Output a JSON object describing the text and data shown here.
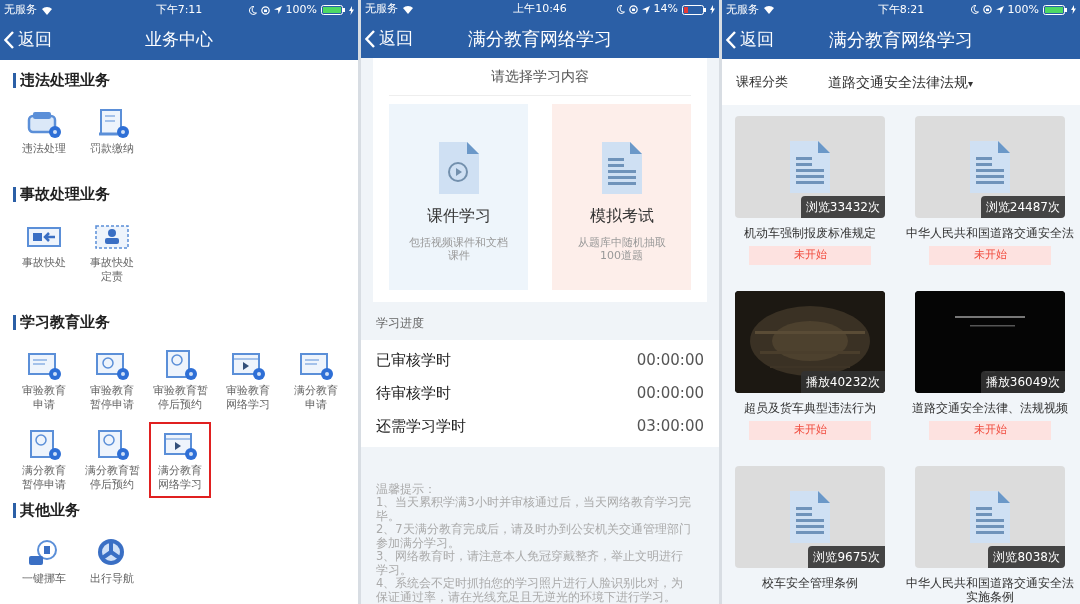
{
  "screen_1": {
    "status_bar": {
      "carrier": "无服务",
      "time": "下午7:11",
      "battery": "100%",
      "battery_low": false
    },
    "nav": {
      "back": "返回",
      "title": "业务中心"
    },
    "sections": [
      {
        "title": "违法处理业务",
        "items": [
          {
            "kind": "car",
            "lines": [
              "违法处理"
            ],
            "highlighted": false
          },
          {
            "kind": "scroll",
            "lines": [
              "罚款缴纳"
            ],
            "highlighted": false
          }
        ]
      },
      {
        "title": "事故处理业务",
        "items": [
          {
            "kind": "accident",
            "lines": [
              "事故快处"
            ],
            "highlighted": false
          },
          {
            "kind": "person",
            "lines": [
              "事故快处",
              "定责"
            ],
            "highlighted": false
          }
        ]
      },
      {
        "title": "学习教育业务",
        "items": [
          {
            "kind": "form",
            "lines": [
              "审验教育",
              "申请"
            ],
            "highlighted": false
          },
          {
            "kind": "clock",
            "lines": [
              "审验教育",
              "暂停申请"
            ],
            "highlighted": false
          },
          {
            "kind": "clock_doc",
            "lines": [
              "审验教育暂",
              "停后预约"
            ],
            "highlighted": false
          },
          {
            "kind": "play",
            "lines": [
              "审验教育",
              "网络学习"
            ],
            "highlighted": false
          },
          {
            "kind": "form",
            "lines": [
              "满分教育",
              "申请"
            ],
            "highlighted": false
          },
          {
            "kind": "clock_doc",
            "lines": [
              "满分教育",
              "暂停申请"
            ],
            "highlighted": false
          },
          {
            "kind": "clock_doc",
            "lines": [
              "满分教育暂",
              "停后预约"
            ],
            "highlighted": false
          },
          {
            "kind": "play",
            "lines": [
              "满分教育",
              "网络学习"
            ],
            "highlighted": true
          }
        ]
      },
      {
        "title": "其他业务",
        "items": [
          {
            "kind": "move_car",
            "lines": [
              "一键挪车"
            ],
            "highlighted": false
          },
          {
            "kind": "wheel",
            "lines": [
              "出行导航"
            ],
            "highlighted": false
          }
        ]
      }
    ]
  },
  "screen_2": {
    "status_bar": {
      "carrier": "无服务",
      "time": "上午10:46",
      "battery": "14%",
      "battery_low": true
    },
    "nav": {
      "back": "返回",
      "title": "满分教育网络学习"
    },
    "choose_title": "请选择学习内容",
    "options": [
      {
        "kind": "video",
        "title": "课件学习",
        "description": "包括视频课件和文档课件"
      },
      {
        "kind": "document",
        "title": "模拟考试",
        "description": "从题库中随机抽取100道题"
      }
    ],
    "progress": {
      "title": "学习进度",
      "rows": [
        {
          "label": "已审核学时",
          "value": "00:00:00"
        },
        {
          "label": "待审核学时",
          "value": "00:00:00"
        },
        {
          "label": "还需学习学时",
          "value": "03:00:00"
        }
      ]
    },
    "tips": {
      "title": "温馨提示：",
      "items": [
        "1、当天累积学满3小时并审核通过后，当天网络教育学习完毕。",
        "2、7天满分教育完成后，请及时办到公安机关交通管理部门参加满分学习。",
        "3、网络教育时，请注意本人免冠穿戴整齐，举止文明进行学习。",
        "4、系统会不定时抓拍您的学习照片进行人脸识别比对，为保证通过率，请在光线充足且无逆光的环境下进行学习。"
      ]
    }
  },
  "screen_3": {
    "status_bar": {
      "carrier": "无服务",
      "time": "下午8:21",
      "battery": "100%",
      "battery_low": false
    },
    "nav": {
      "back": "返回",
      "title": "满分教育网络学习"
    },
    "category": {
      "label": "课程分类",
      "value": "道路交通安全法律法规",
      "caret": "▾"
    },
    "courses": [
      {
        "kind": "document",
        "count": "浏览33432次",
        "title": "机动车强制报废标准规定",
        "status": "未开始"
      },
      {
        "kind": "document",
        "count": "浏览24487次",
        "title": "中华人民共和国道路交通安全法",
        "status": "未开始"
      },
      {
        "kind": "video",
        "count": "播放40232次",
        "title": "超员及货车典型违法行为",
        "status": "未开始"
      },
      {
        "kind": "video",
        "count": "播放36049次",
        "title": "道路交通安全法律、法规视频",
        "status": "未开始"
      },
      {
        "kind": "document",
        "count": "浏览9675次",
        "title": "校车安全管理条例"
      },
      {
        "kind": "document",
        "count": "浏览8038次",
        "title": "中华人民共和国道路交通安全法实施条例"
      }
    ]
  }
}
